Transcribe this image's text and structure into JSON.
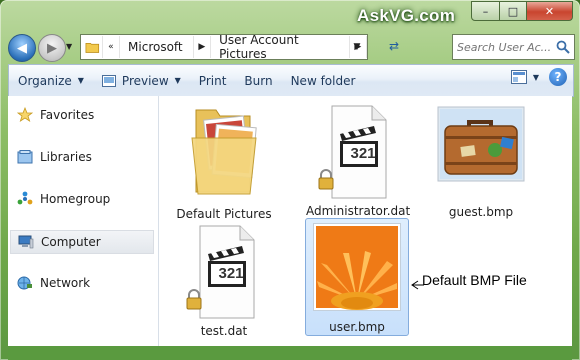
{
  "window": {
    "brand": "AskVG.com",
    "caption_min": "–",
    "caption_max": "□",
    "caption_close": "✕"
  },
  "address": {
    "chevron": "«",
    "crumbs": [
      "Microsoft",
      "User Account Pictures"
    ],
    "separator": "▶",
    "dropdown": "▼"
  },
  "search": {
    "placeholder": "Search User Ac..."
  },
  "toolbar": {
    "organize": "Organize",
    "preview": "Preview",
    "print": "Print",
    "burn": "Burn",
    "new_folder": "New folder",
    "caret": "▼",
    "help": "?"
  },
  "sidebar": {
    "items": [
      {
        "label": "Favorites",
        "icon": "star-icon"
      },
      {
        "label": "Libraries",
        "icon": "libraries-icon"
      },
      {
        "label": "Homegroup",
        "icon": "homegroup-icon"
      },
      {
        "label": "Computer",
        "icon": "computer-icon"
      },
      {
        "label": "Network",
        "icon": "network-icon"
      }
    ],
    "selected": "Computer"
  },
  "files": [
    {
      "name": "Default Pictures",
      "type": "folder"
    },
    {
      "name": "Administrator.dat",
      "type": "media-locked"
    },
    {
      "name": "guest.bmp",
      "type": "image-suitcase"
    },
    {
      "name": "test.dat",
      "type": "media-locked"
    },
    {
      "name": "user.bmp",
      "type": "image-flower",
      "selected": true
    }
  ],
  "media_badge": "321",
  "annotation": "Default BMP File",
  "colors": {
    "accent": "#2a6fb8",
    "selection_bg": "#c8e0fb",
    "selection_border": "#84acdd",
    "window_frame": "#6fa84a"
  }
}
